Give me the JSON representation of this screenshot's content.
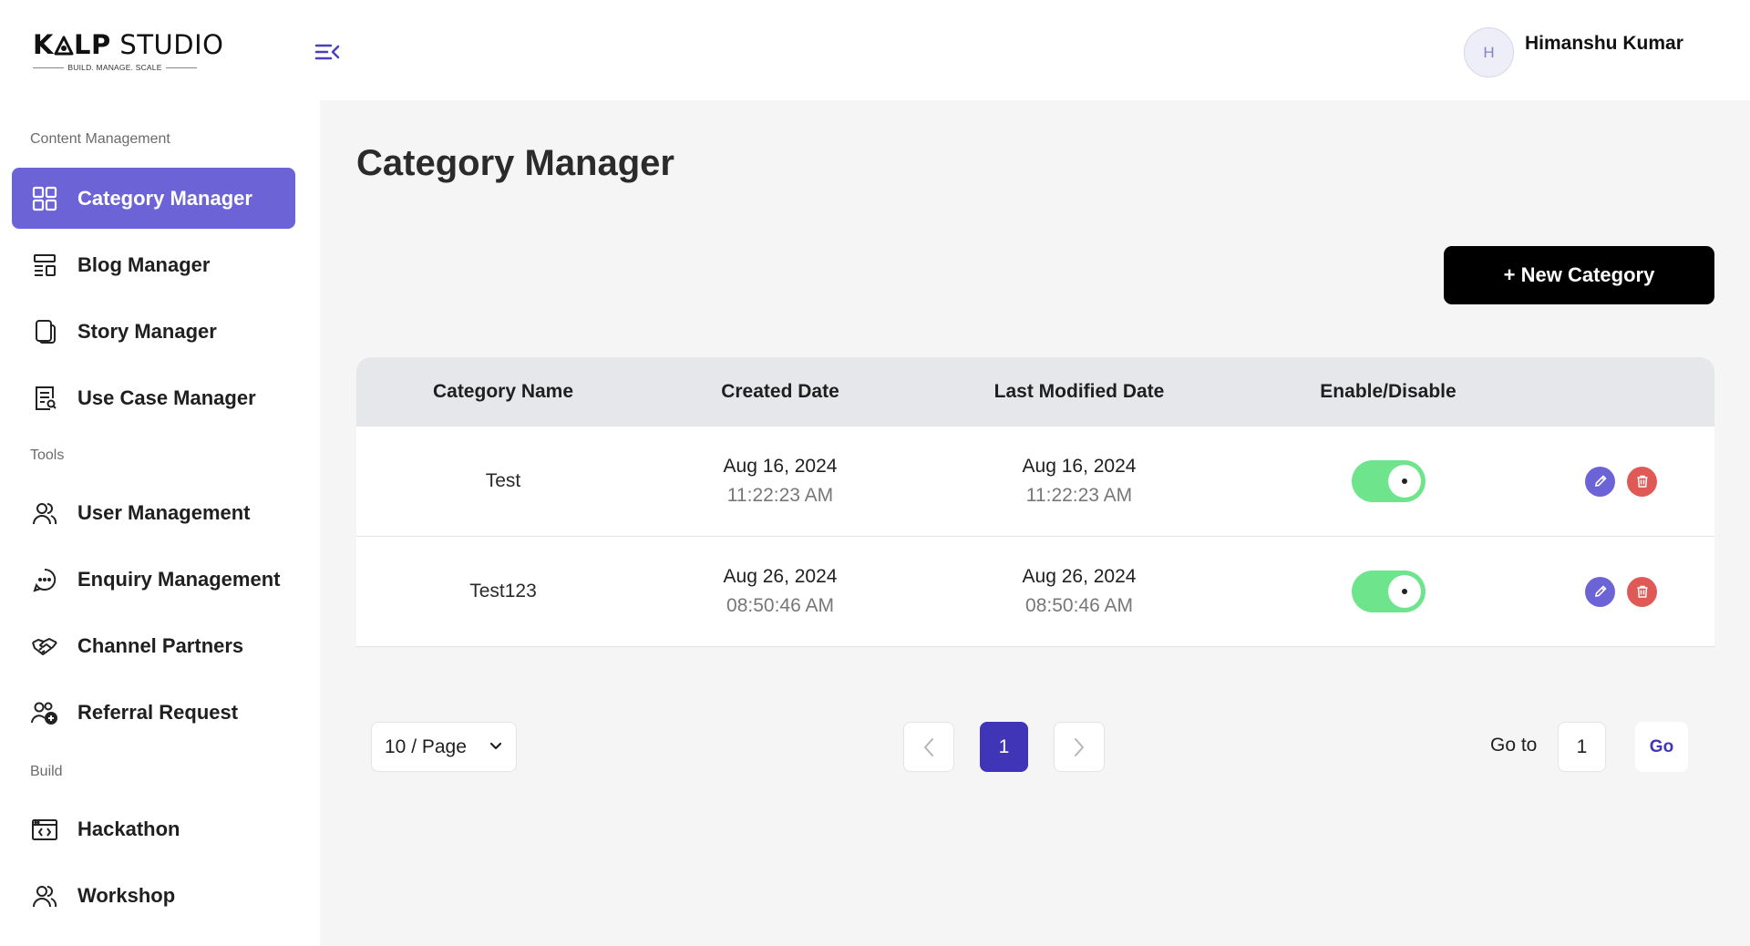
{
  "brand": {
    "logo_part1": "K",
    "logo_part2": "LP",
    "logo_part3": " STUDIO",
    "tagline": "BUILD. MANAGE. SCALE"
  },
  "user": {
    "initial": "H",
    "name": "Himanshu Kumar"
  },
  "sidebar": {
    "sections": [
      {
        "label": "Content Management",
        "items": [
          {
            "label": "Category Manager",
            "icon": "grid-icon",
            "active": true
          },
          {
            "label": "Blog Manager",
            "icon": "layout-icon",
            "active": false
          },
          {
            "label": "Story Manager",
            "icon": "copy-icon",
            "active": false
          },
          {
            "label": "Use Case Manager",
            "icon": "document-search-icon",
            "active": false
          }
        ]
      },
      {
        "label": "Tools",
        "items": [
          {
            "label": "User Management",
            "icon": "users-icon"
          },
          {
            "label": "Enquiry Management",
            "icon": "chat-bubble-icon"
          },
          {
            "label": "Channel Partners",
            "icon": "handshake-icon"
          },
          {
            "label": "Referral Request",
            "icon": "user-add-icon"
          }
        ]
      },
      {
        "label": "Build",
        "items": [
          {
            "label": "Hackathon",
            "icon": "code-window-icon"
          },
          {
            "label": "Workshop",
            "icon": "users-icon"
          }
        ]
      }
    ]
  },
  "main": {
    "title": "Category Manager",
    "new_button_label": "+ New Category",
    "table": {
      "columns": [
        "Category Name",
        "Created Date",
        "Last Modified Date",
        "Enable/Disable"
      ],
      "rows": [
        {
          "name": "Test",
          "created_date": "Aug 16, 2024",
          "created_time": "11:22:23 AM",
          "modified_date": "Aug 16, 2024",
          "modified_time": "11:22:23 AM",
          "enabled": true
        },
        {
          "name": "Test123",
          "created_date": "Aug 26, 2024",
          "created_time": "08:50:46 AM",
          "modified_date": "Aug 26, 2024",
          "modified_time": "08:50:46 AM",
          "enabled": true
        }
      ]
    },
    "pagination": {
      "page_size_label": "10 / Page",
      "current_page": "1",
      "goto_label": "Go to",
      "goto_value": "1",
      "go_label": "Go"
    }
  },
  "colors": {
    "accent": "#6b63d6",
    "page_active": "#3f35b6",
    "toggle_on": "#6ee48c",
    "delete": "#df5a56"
  }
}
